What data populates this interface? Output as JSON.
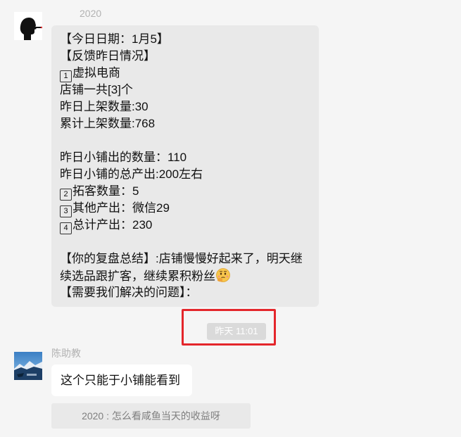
{
  "messages": [
    {
      "sender": "2020",
      "avatar_icon": "silhouette-smoking-avatar-icon",
      "lines": {
        "l1": "【今日日期：1月5】",
        "l2": "【反馈昨日情况】",
        "l3_num": "1",
        "l3_text": "虚拟电商",
        "l4": "店铺一共[3]个",
        "l5": "昨日上架数量:30",
        "l6": "累计上架数量:768",
        "l7": "昨日小铺出的数量：110",
        "l8": "昨日小铺的总产出:200左右",
        "l9_num": "2",
        "l9_text": "拓客数量：5",
        "l10_num": "3",
        "l10_text": "其他产出：微信29",
        "l11_num": "4",
        "l11_text": "总计产出：230",
        "l12": "【你的复盘总结】:店铺慢慢好起来了，明天继",
        "l13": "续选品跟扩客，继续累积粉丝",
        "l13_emoji": "thinking-face-emoji",
        "l14": "【需要我们解决的问题】："
      }
    },
    {
      "sender": "陈助教",
      "avatar_icon": "landscape-photo-avatar-icon",
      "text": "这个只能于小铺能看到"
    }
  ],
  "timestamp": "昨天 11:01",
  "quote": "2020 : 怎么看咸鱼当天的收益呀",
  "colors": {
    "background": "#f5f5f5",
    "incoming_bubble": "#e9e9e9",
    "white_bubble": "#ffffff",
    "highlight": "#e4262b",
    "timestamp_pill": "#dadada"
  }
}
